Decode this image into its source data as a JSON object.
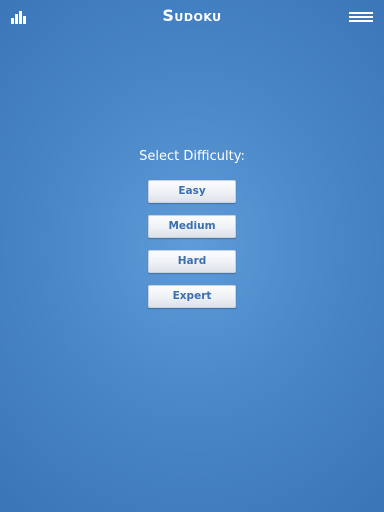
{
  "header": {
    "title": "Sudoku",
    "left_icon": "stats-bars-icon",
    "right_icon": "hamburger-menu-icon"
  },
  "main": {
    "prompt": "Select Difficulty:",
    "buttons": [
      {
        "label": "Easy"
      },
      {
        "label": "Medium"
      },
      {
        "label": "Hard"
      },
      {
        "label": "Expert"
      }
    ]
  },
  "colors": {
    "background": "#4a88c9",
    "button_text": "#3a6fb0",
    "header_text": "#ffffff"
  }
}
